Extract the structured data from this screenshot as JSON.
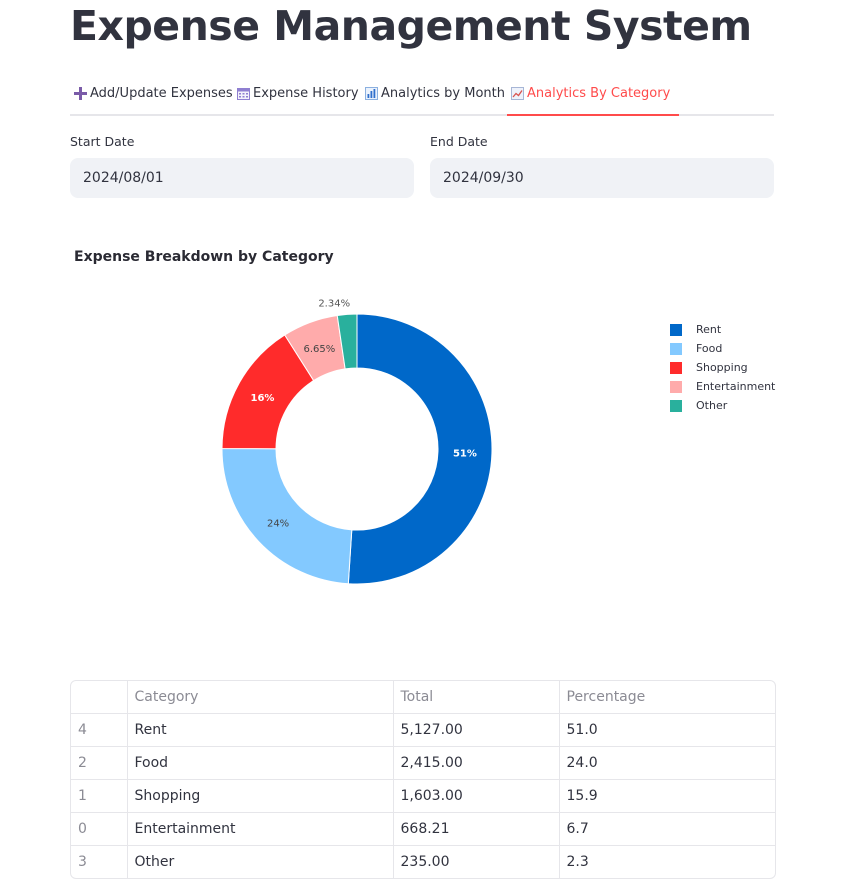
{
  "app": {
    "title": "Expense Management System"
  },
  "tabs": [
    {
      "label": "Add/Update Expenses",
      "icon": "plus-icon",
      "active": false
    },
    {
      "label": "Expense History",
      "icon": "calendar-icon",
      "active": false
    },
    {
      "label": "Analytics by Month",
      "icon": "bar-chart-icon",
      "active": false
    },
    {
      "label": "Analytics By Category",
      "icon": "line-chart-icon",
      "active": true
    }
  ],
  "filters": {
    "start_date": {
      "label": "Start Date",
      "value": "2024/08/01"
    },
    "end_date": {
      "label": "End Date",
      "value": "2024/09/30"
    }
  },
  "chart_data": {
    "type": "pie",
    "title": "Expense Breakdown by Category",
    "donut": true,
    "legend_position": "top-right",
    "labels": [
      "Rent",
      "Food",
      "Shopping",
      "Entertainment",
      "Other"
    ],
    "values": [
      5127.0,
      2415.0,
      1603.0,
      668.21,
      235.0
    ],
    "percent_labels": [
      "51%",
      "24%",
      "16%",
      "6.65%",
      "2.34%"
    ],
    "colors": [
      "#0068c9",
      "#83c9ff",
      "#ff2b2b",
      "#ffabab",
      "#29b09d"
    ]
  },
  "table": {
    "columns": [
      "",
      "Category",
      "Total",
      "Percentage"
    ],
    "rows": [
      [
        "4",
        "Rent",
        "5,127.00",
        "51.0"
      ],
      [
        "2",
        "Food",
        "2,415.00",
        "24.0"
      ],
      [
        "1",
        "Shopping",
        "1,603.00",
        "15.9"
      ],
      [
        "0",
        "Entertainment",
        "668.21",
        "6.7"
      ],
      [
        "3",
        "Other",
        "235.00",
        "2.3"
      ]
    ]
  },
  "colors": {
    "accent": "#ff4b4b",
    "input_bg": "#f0f2f6",
    "text": "#31333f"
  }
}
